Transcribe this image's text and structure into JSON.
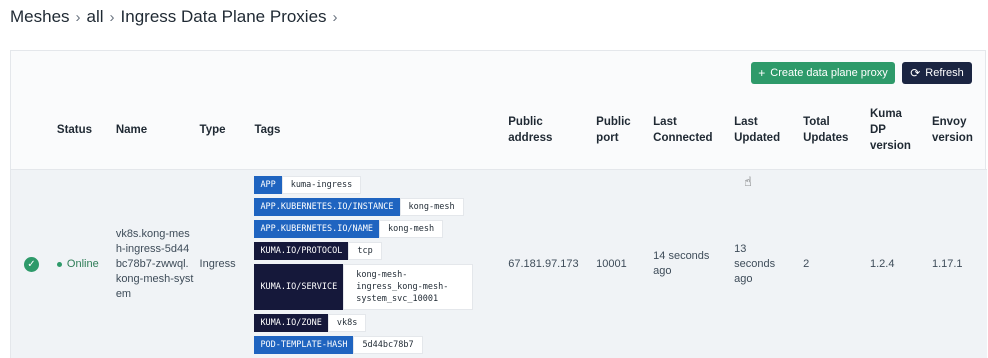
{
  "breadcrumb": {
    "items": [
      "Meshes",
      "all",
      "Ingress Data Plane Proxies"
    ],
    "separator": "›"
  },
  "toolbar": {
    "create_label": "Create data plane proxy",
    "refresh_label": "Refresh"
  },
  "table": {
    "headers": {
      "status": "Status",
      "name": "Name",
      "type": "Type",
      "tags": "Tags",
      "public_address": "Public address",
      "public_port": "Public port",
      "last_connected": "Last Connected",
      "last_updated": "Last Updated",
      "total_updates": "Total Updates",
      "kuma_dp_version": "Kuma DP version",
      "envoy_version": "Envoy version"
    },
    "rows": [
      {
        "status": "Online",
        "name": "vk8s.kong-mesh-ingress-5d44bc78b7-zwwql.kong-mesh-system",
        "type": "Ingress",
        "tags": [
          {
            "key": "APP",
            "value": "kuma-ingress",
            "color": "#1f64c0"
          },
          {
            "key": "APP.KUBERNETES.IO/INSTANCE",
            "value": "kong-mesh",
            "color": "#1f64c0"
          },
          {
            "key": "APP.KUBERNETES.IO/NAME",
            "value": "kong-mesh",
            "color": "#1f64c0"
          },
          {
            "key": "KUMA.IO/PROTOCOL",
            "value": "tcp",
            "color": "#15183a"
          },
          {
            "key": "KUMA.IO/SERVICE",
            "value": "kong-mesh-ingress_kong-mesh-system_svc_10001",
            "color": "#15183a"
          },
          {
            "key": "KUMA.IO/ZONE",
            "value": "vk8s",
            "color": "#15183a"
          },
          {
            "key": "POD-TEMPLATE-HASH",
            "value": "5d44bc78b7",
            "color": "#1f64c0"
          }
        ],
        "public_address": "67.181.97.173",
        "public_port": "10001",
        "last_connected": "14 seconds ago",
        "last_updated": "13 seconds ago",
        "total_updates": "2",
        "kuma_dp_version": "1.2.4",
        "envoy_version": "1.17.1"
      }
    ]
  },
  "colors": {
    "accent_green": "#2e9a6a",
    "dark_navy": "#1b2542",
    "tag_blue": "#1f64c0",
    "tag_navy": "#15183a"
  }
}
